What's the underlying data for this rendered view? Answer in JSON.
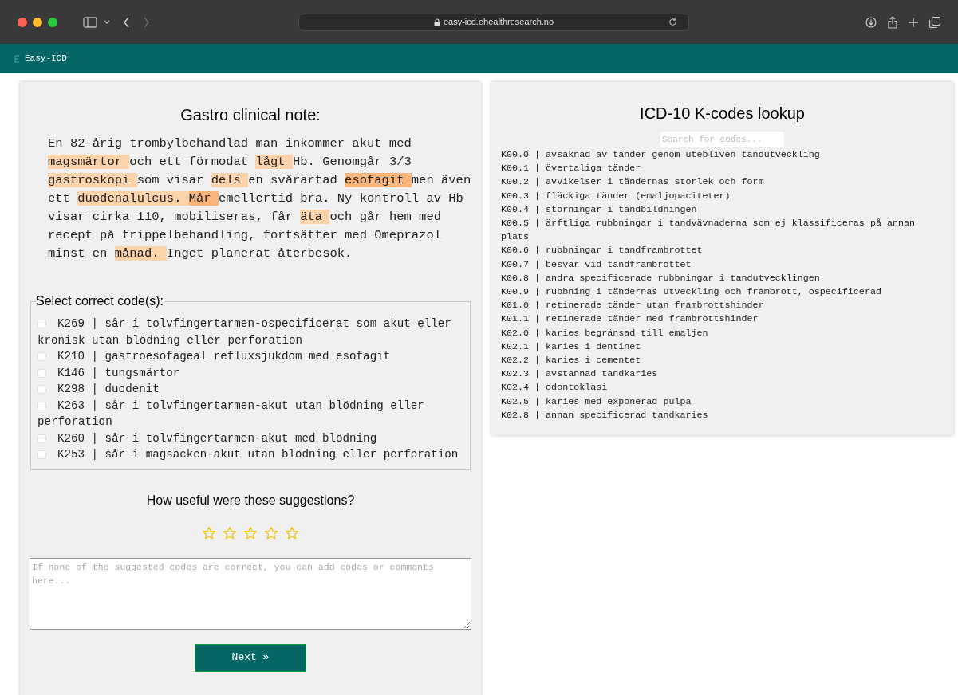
{
  "browser": {
    "url": "easy-icd.ehealthresearch.no"
  },
  "app_bar": {
    "title": "Easy-ICD"
  },
  "note_card": {
    "title": "Gastro clinical note:",
    "segments": [
      {
        "text": "En 82-årig trombylbehandlad man inkommer akut med ",
        "highlighted": false,
        "strong": false
      },
      {
        "text": "magsmärtor ",
        "highlighted": true,
        "strong": false
      },
      {
        "text": "och ett förmodat ",
        "highlighted": false,
        "strong": false
      },
      {
        "text": "lågt ",
        "highlighted": true,
        "strong": false
      },
      {
        "text": "Hb. Genomgår 3/3 ",
        "highlighted": false,
        "strong": false
      },
      {
        "text": "gastroskopi ",
        "highlighted": true,
        "strong": false
      },
      {
        "text": "som visar ",
        "highlighted": false,
        "strong": false
      },
      {
        "text": "dels ",
        "highlighted": true,
        "strong": false
      },
      {
        "text": "en svårartad ",
        "highlighted": false,
        "strong": false
      },
      {
        "text": "esofagit ",
        "highlighted": true,
        "strong": true
      },
      {
        "text": "men även ett ",
        "highlighted": false,
        "strong": false
      },
      {
        "text": "duodenalulcus. ",
        "highlighted": true,
        "strong": false
      },
      {
        "text": "Mår ",
        "highlighted": true,
        "strong": true
      },
      {
        "text": "emellertid bra. Ny kontroll av Hb visar cirka 110, mobiliseras, får ",
        "highlighted": false,
        "strong": false
      },
      {
        "text": "äta ",
        "highlighted": true,
        "strong": false
      },
      {
        "text": "och går hem med recept på trippelbehandling, fortsätter med Omeprazol minst en ",
        "highlighted": false,
        "strong": false
      },
      {
        "text": "månad. ",
        "highlighted": true,
        "strong": false
      },
      {
        "text": "Inget planerat återbesök.",
        "highlighted": false,
        "strong": false
      }
    ],
    "codes_legend": "Select correct code(s):",
    "codes": [
      {
        "label": "K269 | sår i tolvfingertarmen-ospecificerat som akut eller kronisk utan blödning eller perforation",
        "checked": false
      },
      {
        "label": "K210 | gastroesofageal refluxsjukdom med esofagit",
        "checked": false
      },
      {
        "label": "K146 | tungsmärtor",
        "checked": false
      },
      {
        "label": "K298 | duodenit",
        "checked": false
      },
      {
        "label": "K263 | sår i tolvfingertarmen-akut utan blödning eller perforation",
        "checked": false
      },
      {
        "label": "K260 | sår i tolvfingertarmen-akut med blödning",
        "checked": false
      },
      {
        "label": "K253 | sår i magsäcken-akut utan blödning eller perforation",
        "checked": false
      }
    ],
    "rating": {
      "prompt": "How useful were these suggestions?",
      "stars": 0
    },
    "comments": {
      "placeholder": "If none of the suggested codes are correct, you can add codes or comments here..."
    },
    "next_button": "Next »"
  },
  "lookup": {
    "title": "ICD-10 K-codes lookup",
    "search": {
      "placeholder": "Search for codes..."
    },
    "entries": [
      "K00.0 | avsaknad av tänder genom utebliven tandutveckling",
      "K00.1 | övertaliga tänder",
      "K00.2 | avvikelser i tändernas storlek och form",
      "K00.3 | fläckiga tänder (emaljopaciteter)",
      "K00.4 | störningar i tandbildningen",
      "K00.5 | ärftliga rubbningar i tandvävnaderna som ej klassificeras på annan plats",
      "K00.6 | rubbningar i tandframbrottet",
      "K00.7 | besvär vid tandframbrottet",
      "K00.8 | andra specificerade rubbningar i tandutvecklingen",
      "K00.9 | rubbning i tändernas utveckling och frambrott, ospecificerad",
      "K01.0 | retinerade tänder utan frambrottshinder",
      "K01.1 | retinerade tänder med frambrottshinder",
      "K02.0 | karies begränsad till emaljen",
      "K02.1 | karies i dentinet",
      "K02.2 | karies i cementet",
      "K02.3 | avstannad tandkaries",
      "K02.4 | odontoklasi",
      "K02.5 | karies med exponerad pulpa",
      "K02.8 | annan specificerad tandkaries"
    ]
  }
}
